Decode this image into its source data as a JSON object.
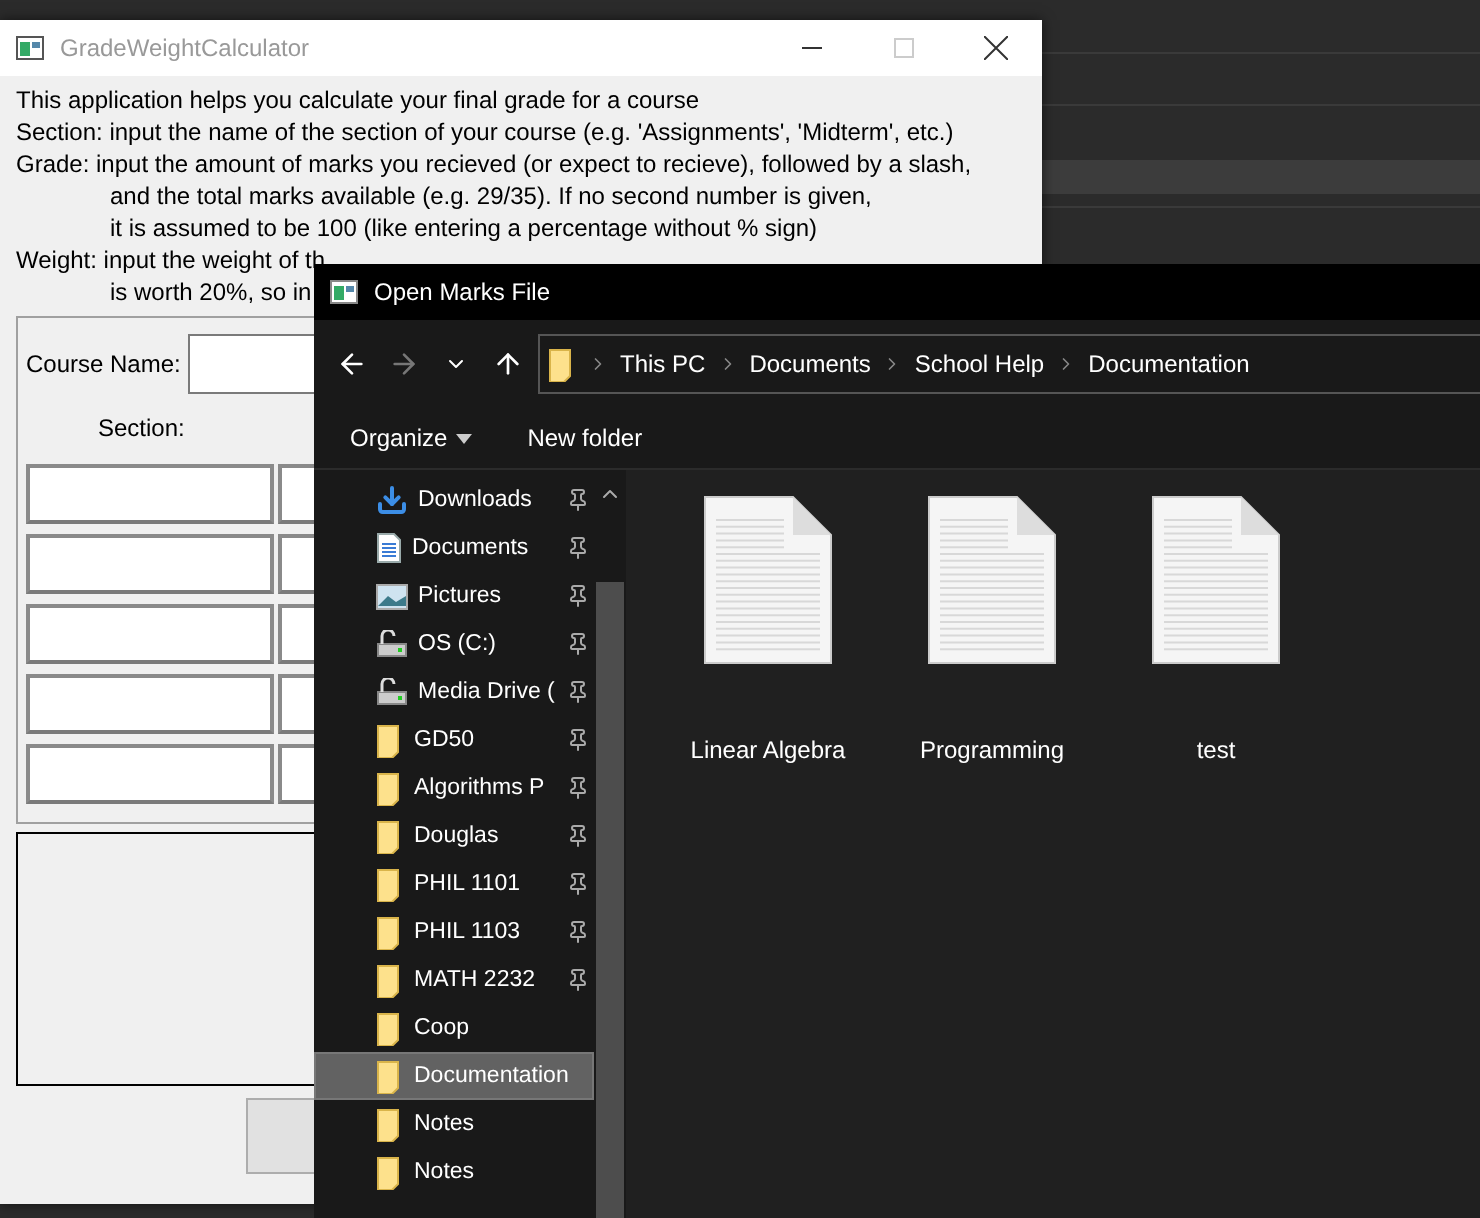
{
  "main_window": {
    "title": "GradeWeightCalculator",
    "instructions": [
      {
        "lines": [
          "This application helps you calculate your final grade for a course"
        ]
      },
      {
        "lines": [
          "Section: input the name of the section of your course (e.g. 'Assignments', 'Midterm', etc.)"
        ]
      },
      {
        "lines": [
          "Grade: input the amount of marks you recieved (or expect to recieve), followed by a slash,",
          "and the total marks available (e.g. 29/35). If no second number is given,",
          "it is assumed to be 100 (like entering a percentage without % sign)"
        ]
      },
      {
        "lines": [
          "Weight: input the weight of th",
          "is worth 20%, so in"
        ]
      }
    ],
    "course_name_label": "Course Name:",
    "section_label": "Section:"
  },
  "dialog": {
    "title": "Open Marks File",
    "nav_buttons": [
      {
        "kind": "back",
        "disabled": false
      },
      {
        "kind": "forward",
        "disabled": true
      },
      {
        "kind": "recent",
        "disabled": false
      },
      {
        "kind": "up",
        "disabled": false
      }
    ],
    "breadcrumb": [
      "This PC",
      "Documents",
      "School Help",
      "Documentation"
    ],
    "toolbar": {
      "organize": "Organize",
      "new_folder": "New folder"
    },
    "nav_items": [
      {
        "label": "Downloads",
        "kind": "downloads",
        "pinned": true,
        "selected": false
      },
      {
        "label": "Documents",
        "kind": "documents",
        "pinned": true,
        "selected": false
      },
      {
        "label": "Pictures",
        "kind": "pictures",
        "pinned": true,
        "selected": false
      },
      {
        "label": "OS (C:)",
        "kind": "drive",
        "pinned": true,
        "selected": false
      },
      {
        "label": "Media Drive (",
        "kind": "drive",
        "pinned": true,
        "selected": false
      },
      {
        "label": "GD50",
        "kind": "folder",
        "pinned": true,
        "selected": false
      },
      {
        "label": "Algorithms P",
        "kind": "folder",
        "pinned": true,
        "selected": false
      },
      {
        "label": "Douglas",
        "kind": "folder",
        "pinned": true,
        "selected": false
      },
      {
        "label": "PHIL 1101",
        "kind": "folder",
        "pinned": true,
        "selected": false
      },
      {
        "label": "PHIL 1103",
        "kind": "folder",
        "pinned": true,
        "selected": false
      },
      {
        "label": "MATH 2232",
        "kind": "folder",
        "pinned": true,
        "selected": false
      },
      {
        "label": "Coop",
        "kind": "folder",
        "pinned": false,
        "selected": false
      },
      {
        "label": "Documentation",
        "kind": "folder",
        "pinned": false,
        "selected": true
      },
      {
        "label": "Notes",
        "kind": "folder",
        "pinned": false,
        "selected": false
      },
      {
        "label": "Notes",
        "kind": "folder",
        "pinned": false,
        "selected": false
      }
    ],
    "files": [
      {
        "name": "Linear Algebra"
      },
      {
        "name": "Programming"
      },
      {
        "name": "test"
      }
    ]
  }
}
